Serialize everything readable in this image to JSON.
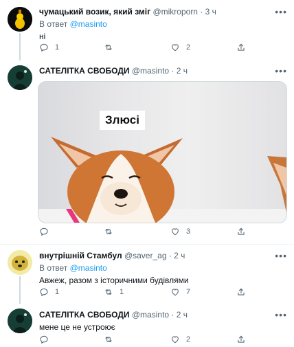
{
  "tweets": [
    {
      "name": "чумацький возик, який зміг",
      "handle": "@mikroporn",
      "time": "· 3 ч",
      "reply_prefix": "В ответ",
      "reply_to": "@masinto",
      "text": "ні",
      "replies": "1",
      "retweets": "",
      "likes": "2"
    },
    {
      "name": "САТЕЛІТКА СВОБОДИ",
      "handle": "@masinto",
      "time": "· 2 ч",
      "media_caption": "Злюсі",
      "replies": "",
      "retweets": "",
      "likes": "3"
    },
    {
      "name": "внутрішній Стамбул",
      "handle": "@saver_ag",
      "time": "· 2 ч",
      "reply_prefix": "В ответ",
      "reply_to": "@masinto",
      "text": "Авжеж, разом з історичними будівлями",
      "replies": "1",
      "retweets": "1",
      "likes": "7"
    },
    {
      "name": "САТЕЛІТКА СВОБОДИ",
      "handle": "@masinto",
      "time": "· 2 ч",
      "text": "мене це не устроює",
      "replies": "",
      "retweets": "",
      "likes": "2"
    }
  ],
  "more_glyph": "•••",
  "icons": [
    "reply-icon",
    "retweet-icon",
    "like-icon",
    "share-icon",
    "more-icon"
  ]
}
